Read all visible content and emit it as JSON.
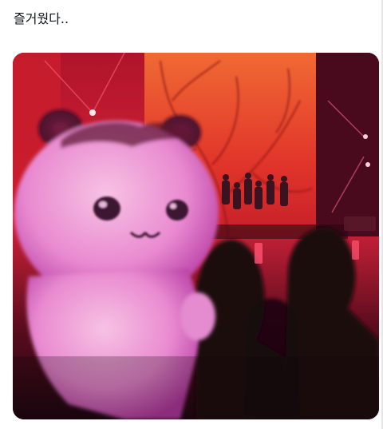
{
  "post": {
    "text": "즐거웠다.."
  },
  "media": {
    "kind": "concert photo with plush toy",
    "colors": {
      "stage_red": "#d81e1e",
      "screen_orange": "#e4552a",
      "plush_pink": "#f1a0cf",
      "dark": "#1a0710"
    }
  }
}
